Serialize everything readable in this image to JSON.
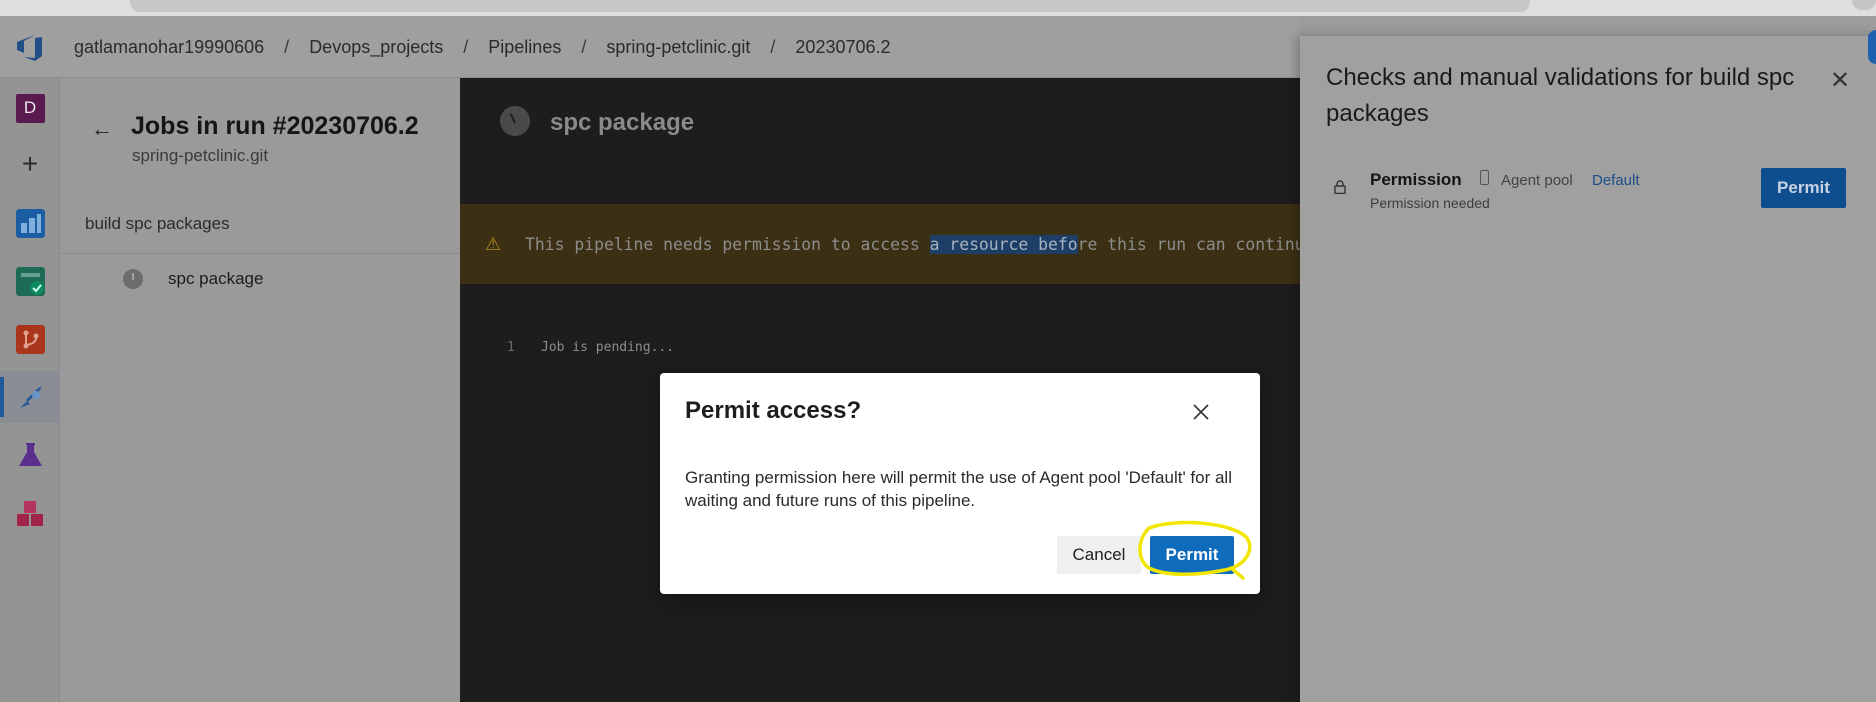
{
  "breadcrumb": [
    "gatlamanohar19990606",
    "Devops_projects",
    "Pipelines",
    "spring-petclinic.git",
    "20230706.2"
  ],
  "rail": {
    "avatar_letter": "D",
    "items": [
      "avatar-d",
      "plus-icon",
      "boards-icon",
      "test-plans-check-icon",
      "repos-icon",
      "pipelines-icon",
      "test-plans-flask-icon",
      "artifacts-icon"
    ]
  },
  "jobs_panel": {
    "title": "Jobs in run #20230706.2",
    "subtitle": "spring-petclinic.git",
    "stage": "build spc packages",
    "job": "spc package"
  },
  "log_panel": {
    "title": "spc package",
    "warning_before": "This pipeline needs permission to access ",
    "warning_highlight": "a resource befo",
    "warning_after": "re this run can continue",
    "line_number": "1",
    "line_text": "Job is pending..."
  },
  "checks_panel": {
    "title": "Checks and manual validations for build spc packages",
    "permission_label": "Permission",
    "pool_type": "Agent pool",
    "pool_name": "Default",
    "status": "Permission needed",
    "permit_label": "Permit"
  },
  "dialog": {
    "title": "Permit access?",
    "body": "Granting permission here will permit the use of Agent pool 'Default' for all waiting and future runs of this pipeline.",
    "cancel_label": "Cancel",
    "permit_label": "Permit"
  },
  "colors": {
    "primary": "#0f6cbd",
    "annotation": "#f2e600",
    "warning_icon": "#b38a1c"
  }
}
